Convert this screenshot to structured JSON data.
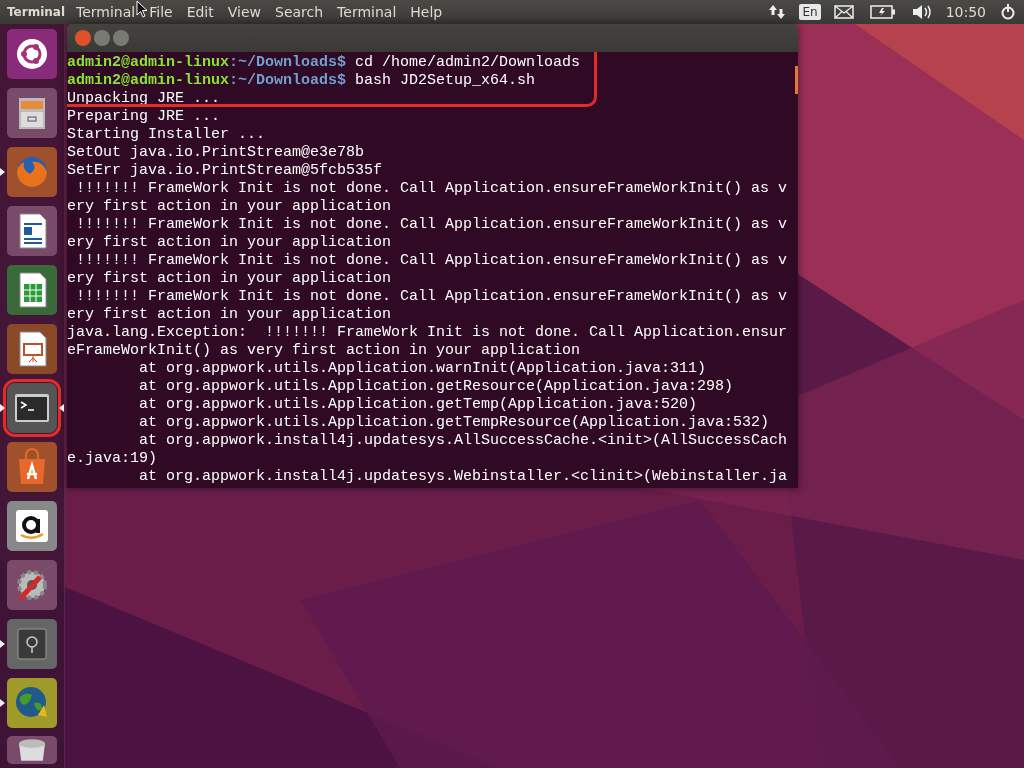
{
  "top_bar": {
    "app_name": "Terminal",
    "menus": [
      "Terminal",
      "File",
      "Edit",
      "View",
      "Search",
      "Terminal",
      "Help"
    ],
    "keyboard": "En",
    "clock": "10:50"
  },
  "launcher": [
    {
      "kind": "dash",
      "running": false,
      "focused": false,
      "highlighted": false
    },
    {
      "kind": "files",
      "running": false,
      "focused": false,
      "highlighted": false
    },
    {
      "kind": "browser",
      "running": true,
      "focused": false,
      "highlighted": false
    },
    {
      "kind": "writer",
      "running": false,
      "focused": false,
      "highlighted": false
    },
    {
      "kind": "calc",
      "running": false,
      "focused": false,
      "highlighted": false
    },
    {
      "kind": "impress",
      "running": false,
      "focused": false,
      "highlighted": false
    },
    {
      "kind": "terminal",
      "running": true,
      "focused": true,
      "highlighted": true
    },
    {
      "kind": "software",
      "running": false,
      "focused": false,
      "highlighted": false
    },
    {
      "kind": "amazon",
      "running": false,
      "focused": false,
      "highlighted": false
    },
    {
      "kind": "settings",
      "running": false,
      "focused": false,
      "highlighted": false
    },
    {
      "kind": "safe",
      "running": true,
      "focused": false,
      "highlighted": false
    },
    {
      "kind": "globe",
      "running": true,
      "focused": false,
      "highlighted": false
    },
    {
      "kind": "trash",
      "running": false,
      "focused": false,
      "highlighted": false
    }
  ],
  "terminal": {
    "lines": [
      {
        "kind": "prompt",
        "user": "admin2@admin-linux",
        "path": ":~/Downloads$",
        "command": " cd /home/admin2/Downloads",
        "highlighted": true
      },
      {
        "kind": "prompt",
        "user": "admin2@admin-linux",
        "path": ":~/Downloads$",
        "command": " bash JD2Setup_x64.sh",
        "highlighted": true
      },
      {
        "kind": "output",
        "text": "Unpacking JRE ...",
        "highlighted": true
      },
      {
        "kind": "output",
        "text": "Preparing JRE ...",
        "highlighted": false
      },
      {
        "kind": "output",
        "text": "Starting Installer ...",
        "highlighted": false
      },
      {
        "kind": "output",
        "text": "SetOut java.io.PrintStream@e3e78b",
        "highlighted": false
      },
      {
        "kind": "output",
        "text": "SetErr java.io.PrintStream@5fcb535f",
        "highlighted": false
      },
      {
        "kind": "output",
        "text": " !!!!!!! FrameWork Init is not done. Call Application.ensureFrameWorkInit() as v",
        "highlighted": false
      },
      {
        "kind": "output",
        "text": "ery first action in your application",
        "highlighted": false
      },
      {
        "kind": "output",
        "text": " !!!!!!! FrameWork Init is not done. Call Application.ensureFrameWorkInit() as v",
        "highlighted": false
      },
      {
        "kind": "output",
        "text": "ery first action in your application",
        "highlighted": false
      },
      {
        "kind": "output",
        "text": " !!!!!!! FrameWork Init is not done. Call Application.ensureFrameWorkInit() as v",
        "highlighted": false
      },
      {
        "kind": "output",
        "text": "ery first action in your application",
        "highlighted": false
      },
      {
        "kind": "output",
        "text": " !!!!!!! FrameWork Init is not done. Call Application.ensureFrameWorkInit() as v",
        "highlighted": false
      },
      {
        "kind": "output",
        "text": "ery first action in your application",
        "highlighted": false
      },
      {
        "kind": "output",
        "text": "java.lang.Exception:  !!!!!!! FrameWork Init is not done. Call Application.ensur",
        "highlighted": false
      },
      {
        "kind": "output",
        "text": "eFrameWorkInit() as very first action in your application",
        "highlighted": false
      },
      {
        "kind": "output",
        "text": "        at org.appwork.utils.Application.warnInit(Application.java:311)",
        "highlighted": false
      },
      {
        "kind": "output",
        "text": "        at org.appwork.utils.Application.getResource(Application.java:298)",
        "highlighted": false
      },
      {
        "kind": "output",
        "text": "        at org.appwork.utils.Application.getTemp(Application.java:520)",
        "highlighted": false
      },
      {
        "kind": "output",
        "text": "        at org.appwork.utils.Application.getTempResource(Application.java:532)",
        "highlighted": false
      },
      {
        "kind": "output",
        "text": "        at org.appwork.install4j.updatesys.AllSuccessCache.<init>(AllSuccessCach",
        "highlighted": false
      },
      {
        "kind": "output",
        "text": "e.java:19)",
        "highlighted": false
      },
      {
        "kind": "output",
        "text": "        at org.appwork.install4j.updatesys.Webinstaller.<clinit>(Webinstaller.ja",
        "highlighted": false
      }
    ]
  }
}
